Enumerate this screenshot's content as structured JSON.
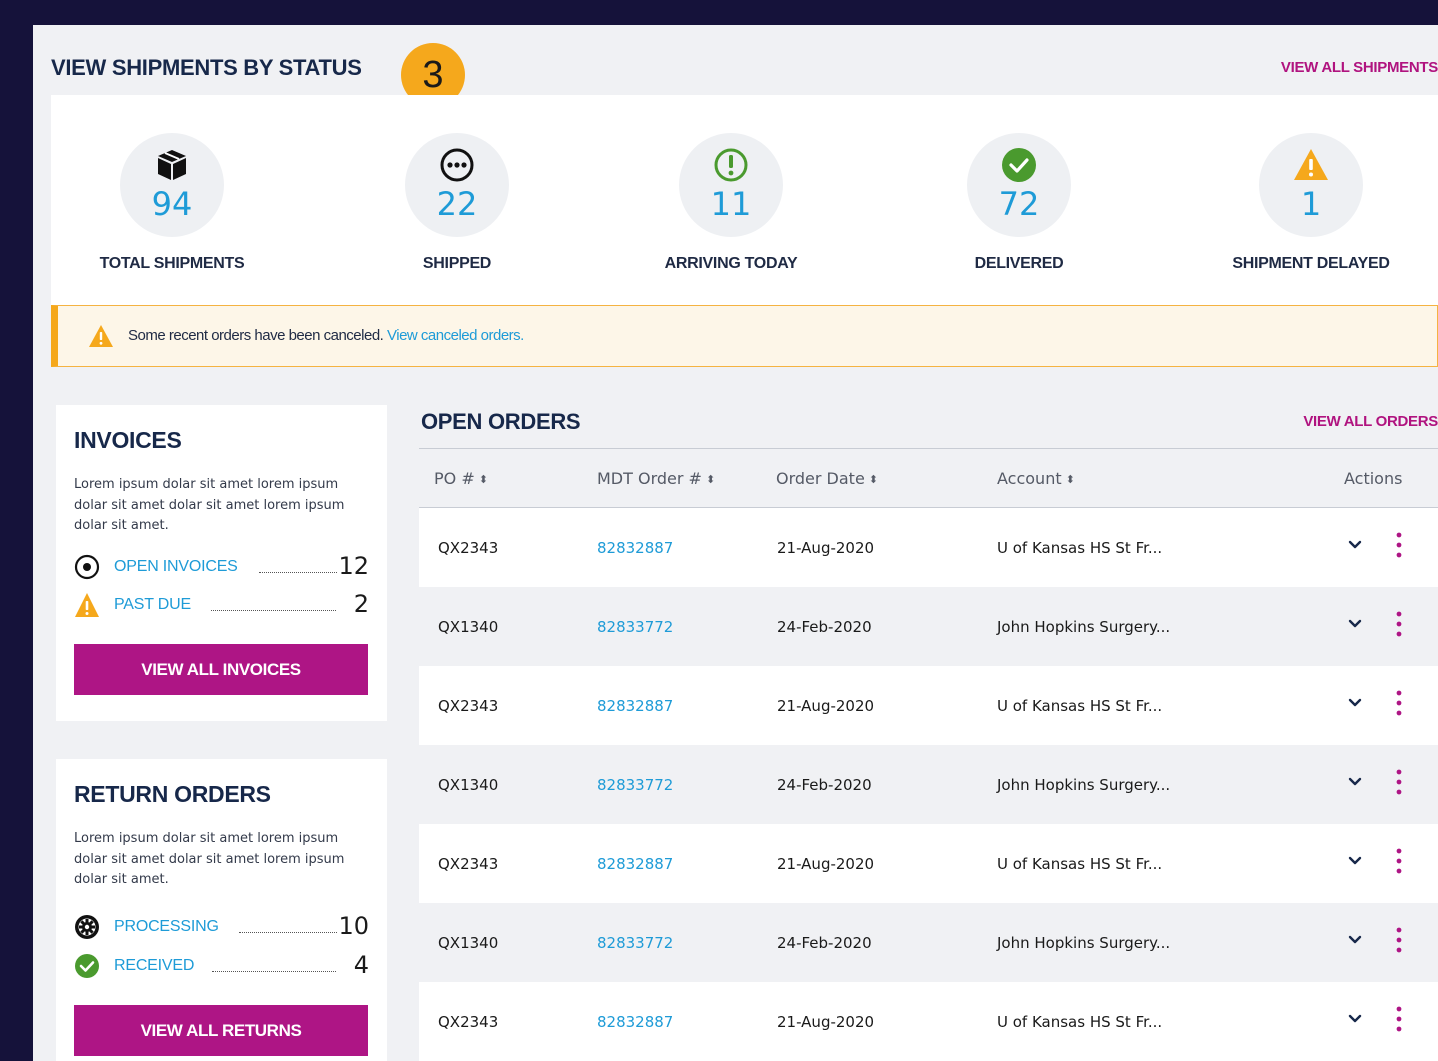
{
  "header": {
    "title": "VIEW SHIPMENTS BY STATUS",
    "step_badge": "3",
    "view_all_label": "VIEW ALL SHIPMENTS"
  },
  "status_items": [
    {
      "count": "94",
      "label": "TOTAL SHIPMENTS",
      "icon": "package-icon"
    },
    {
      "count": "22",
      "label": "SHIPPED",
      "icon": "in-transit-dots-icon"
    },
    {
      "count": "11",
      "label": "ARRIVING TODAY",
      "icon": "alert-circle-icon"
    },
    {
      "count": "72",
      "label": "DELIVERED",
      "icon": "check-circle-icon"
    },
    {
      "count": "1",
      "label": "SHIPMENT DELAYED",
      "icon": "warning-triangle-icon"
    }
  ],
  "alert": {
    "text": "Some recent orders have been canceled.",
    "link": "View canceled orders."
  },
  "invoices": {
    "title": "INVOICES",
    "description": "Lorem ipsum dolar sit amet lorem ipsum dolar sit amet dolar sit amet lorem ipsum dolar sit amet.",
    "open_label": "OPEN INVOICES",
    "open_value": "12",
    "pastdue_label": "PAST DUE",
    "pastdue_value": "2",
    "button": "VIEW ALL INVOICES"
  },
  "returns": {
    "title": "RETURN ORDERS",
    "description": "Lorem ipsum dolar sit amet lorem ipsum dolar sit amet dolar sit amet lorem ipsum dolar sit amet.",
    "processing_label": "PROCESSING",
    "processing_value": "10",
    "received_label": "RECEIVED",
    "received_value": "4",
    "button": "VIEW ALL RETURNS"
  },
  "orders": {
    "title": "OPEN ORDERS",
    "view_all_label": "VIEW ALL ORDERS",
    "columns": [
      "PO #",
      "MDT Order #",
      "Order Date",
      "Account",
      "Actions"
    ],
    "sort_glyph": "⬍",
    "rows": [
      {
        "po": "QX2343",
        "mdt": "82832887",
        "date": "21-Aug-2020",
        "account": "U of Kansas HS St Fr..."
      },
      {
        "po": "QX1340",
        "mdt": "82833772",
        "date": "24-Feb-2020",
        "account": "John Hopkins Surgery..."
      },
      {
        "po": "QX2343",
        "mdt": "82832887",
        "date": "21-Aug-2020",
        "account": "U of Kansas HS St Fr..."
      },
      {
        "po": "QX1340",
        "mdt": "82833772",
        "date": "24-Feb-2020",
        "account": "John Hopkins Surgery..."
      },
      {
        "po": "QX2343",
        "mdt": "82832887",
        "date": "21-Aug-2020",
        "account": "U of Kansas HS St Fr..."
      },
      {
        "po": "QX1340",
        "mdt": "82833772",
        "date": "24-Feb-2020",
        "account": "John Hopkins Surgery..."
      },
      {
        "po": "QX2343",
        "mdt": "82832887",
        "date": "21-Aug-2020",
        "account": "U of Kansas HS St Fr..."
      }
    ]
  },
  "colors": {
    "page_bg": "#15123a",
    "accent_magenta": "#ae1585",
    "link_blue": "#1e9bd7",
    "warning_orange": "#f5a81c",
    "success_green": "#4a9a2e"
  }
}
